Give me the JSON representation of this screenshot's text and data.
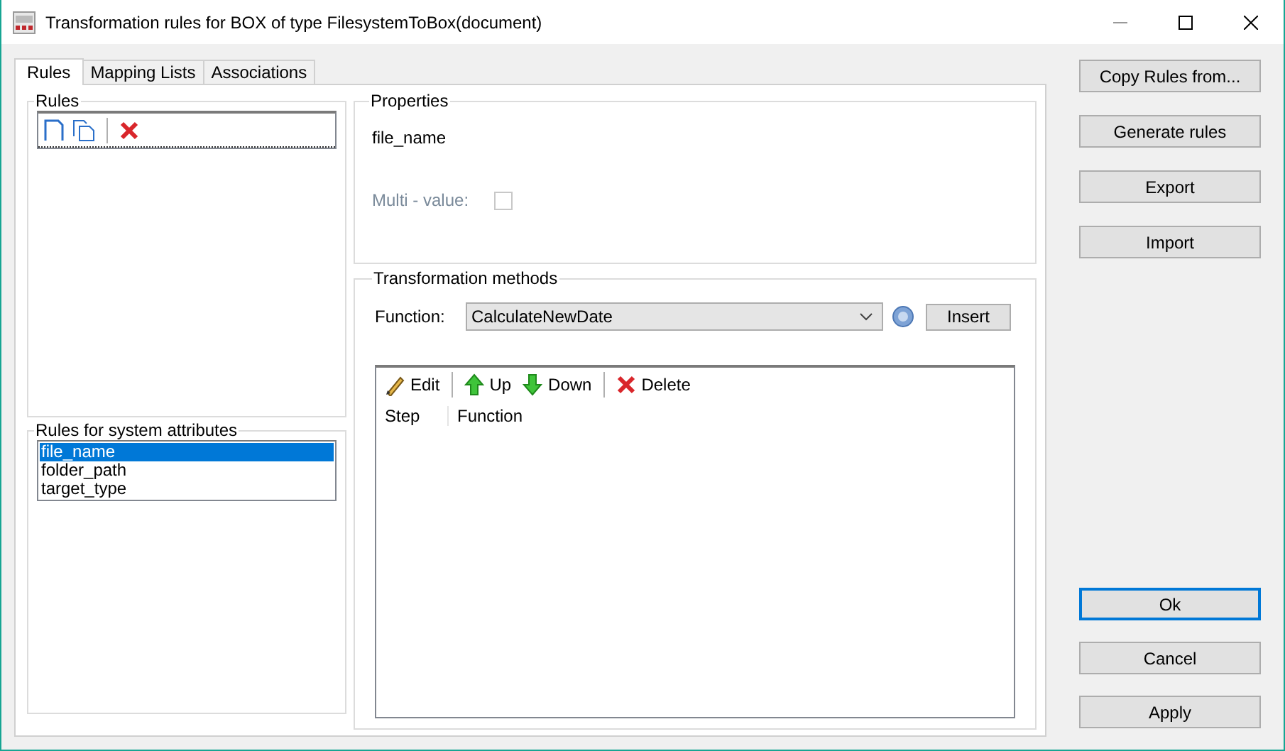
{
  "window": {
    "title": "Transformation rules for BOX of type FilesystemToBox(document)"
  },
  "tabs": [
    {
      "label": "Rules",
      "selected": true
    },
    {
      "label": "Mapping Lists",
      "selected": false
    },
    {
      "label": "Associations",
      "selected": false
    }
  ],
  "rules": {
    "title": "Rules"
  },
  "system_attributes": {
    "title": "Rules for system attributes",
    "items": [
      {
        "label": "file_name",
        "selected": true
      },
      {
        "label": "folder_path",
        "selected": false
      },
      {
        "label": "target_type",
        "selected": false
      }
    ]
  },
  "properties": {
    "title": "Properties",
    "name": "file_name",
    "multi_value": {
      "label": "Multi - value:",
      "checked": false,
      "disabled": true
    }
  },
  "transformation": {
    "title": "Transformation methods",
    "function_label": "Function:",
    "function_value": "CalculateNewDate",
    "insert": "Insert",
    "toolbar": [
      {
        "kind": "edit",
        "label": "Edit"
      },
      {
        "kind": "up",
        "label": "Up"
      },
      {
        "kind": "down",
        "label": "Down"
      },
      {
        "kind": "delete",
        "label": "Delete"
      }
    ],
    "columns": [
      "Step",
      "Function"
    ]
  },
  "side_buttons": [
    {
      "label": "Copy Rules from...",
      "default": false
    },
    {
      "label": "Generate rules",
      "default": false
    },
    {
      "label": "Export",
      "default": false
    },
    {
      "label": "Import",
      "default": false
    }
  ],
  "bottom_buttons": [
    {
      "label": "Ok",
      "default": true
    },
    {
      "label": "Cancel",
      "default": false
    },
    {
      "label": "Apply",
      "default": false
    }
  ]
}
